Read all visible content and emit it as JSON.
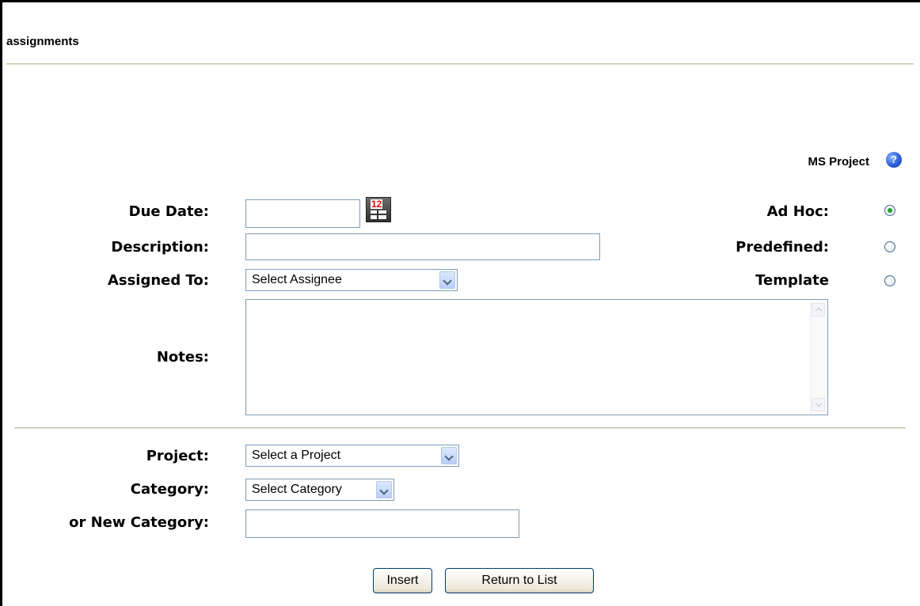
{
  "page": {
    "title": "assignments"
  },
  "ms_project": {
    "label": "MS Project",
    "help_icon": "help-icon",
    "help_glyph": "?"
  },
  "form": {
    "due_date": {
      "label": "Due Date:",
      "value": "",
      "calendar_icon": "calendar-icon",
      "calendar_digits": "12"
    },
    "description": {
      "label": "Description:",
      "value": ""
    },
    "assigned_to": {
      "label": "Assigned To:",
      "selected": "Select Assignee"
    },
    "notes": {
      "label": "Notes:",
      "value": ""
    },
    "project": {
      "label": "Project:",
      "selected": "Select a Project"
    },
    "category": {
      "label": "Category:",
      "selected": "Select Category"
    },
    "new_category": {
      "label": "or New Category:",
      "value": ""
    }
  },
  "type_options": [
    {
      "label": "Ad Hoc:",
      "checked": true
    },
    {
      "label": "Predefined:",
      "checked": false
    },
    {
      "label": "Template",
      "checked": false
    }
  ],
  "buttons": {
    "insert": "Insert",
    "return_to_list": "Return to List"
  },
  "colors": {
    "radio_selected": "#21a121",
    "input_border": "#7f9db9",
    "button_border": "#003c74"
  }
}
